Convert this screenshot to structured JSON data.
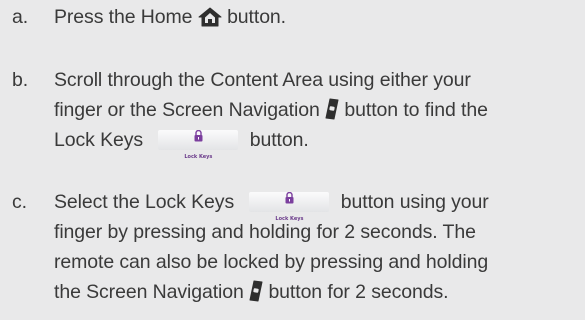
{
  "steps": [
    {
      "marker": "a.",
      "text_before": "Press the Home",
      "icon": "home-icon",
      "text_after": "button."
    },
    {
      "marker": "b.",
      "line1": "Scroll through the Content Area using either your",
      "line2_before": "finger or the Screen Navigation",
      "icon": "screen-navigation-icon",
      "line2_after": "button to find the",
      "line3_before": "Lock Keys",
      "button_label": "Lock Keys",
      "line3_after": "button."
    },
    {
      "marker": "c.",
      "line1_before": "Select the Lock Keys",
      "button_label": "Lock Keys",
      "line1_after": "button using your",
      "line2": "finger by pressing and holding for 2 seconds. The",
      "line3": "remote can also be locked by pressing and holding",
      "line4_before": "the Screen Navigation",
      "icon": "screen-navigation-icon",
      "line4_after": "button for 2 seconds."
    }
  ],
  "colors": {
    "background": "#e9e9ea",
    "text": "#3a3a3a",
    "icon": "#2e2e2e",
    "lock_icon": "#7b3f9e"
  }
}
